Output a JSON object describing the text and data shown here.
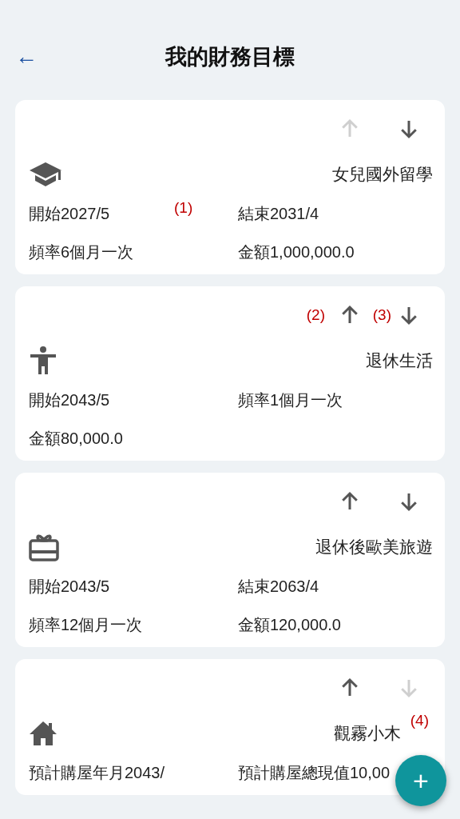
{
  "header": {
    "back": "←",
    "title": "我的財務目標"
  },
  "goals": [
    {
      "kind": "graduation",
      "up_enabled": false,
      "down_enabled": true,
      "name": "女兒國外留學",
      "fields": [
        "開始2027/5",
        "結束2031/4",
        "頻率6個月一次",
        "金額1,000,000.0"
      ],
      "row_note": "(1)"
    },
    {
      "kind": "person",
      "up_enabled": true,
      "down_enabled": true,
      "name": "退休生活",
      "fields": [
        "開始2043/5",
        "頻率1個月一次",
        "金額80,000.0"
      ],
      "up_note": "(2)",
      "down_note": "(3)"
    },
    {
      "kind": "gift",
      "up_enabled": true,
      "down_enabled": true,
      "name": "退休後歐美旅遊",
      "fields": [
        "開始2043/5",
        "結束2063/4",
        "頻率12個月一次",
        "金額120,000.0"
      ]
    },
    {
      "kind": "house",
      "up_enabled": true,
      "down_enabled": false,
      "name": "觀霧小木",
      "fields": [
        "預計購屋年月2043/",
        "預計購屋總現值10,00"
      ],
      "down_note": "(4)"
    }
  ],
  "fab": {
    "label": "+"
  }
}
